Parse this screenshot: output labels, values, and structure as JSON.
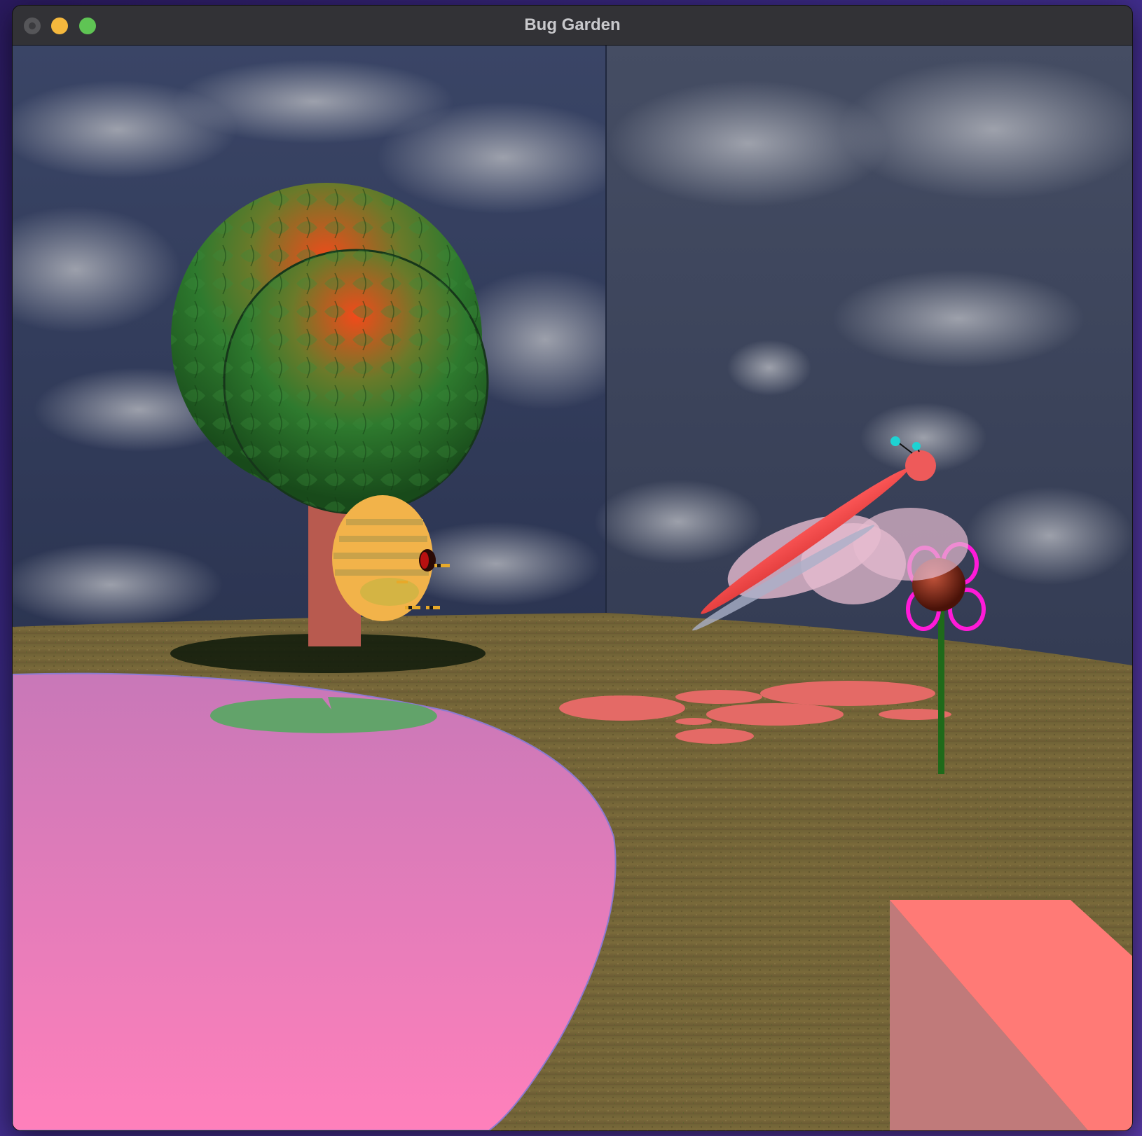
{
  "window": {
    "title": "Bug Garden",
    "controls": [
      "close",
      "minimize",
      "maximize"
    ]
  },
  "scene": {
    "objects": [
      "sky-wall-left",
      "sky-wall-right",
      "grass-ground",
      "tree",
      "beehive",
      "bees",
      "pond",
      "lily-pad",
      "dragonfly",
      "flower",
      "petal-patches",
      "pink-cube"
    ],
    "colors": {
      "pond": "#e47ab8",
      "lily_pad": "#62a36a",
      "tree_trunk": "#b85a4f",
      "beehive": "#f2b34a",
      "dragonfly": "#e84545",
      "flower_petals": "#ff1ad8",
      "flower_center": "#7a2418",
      "petal_patches": "#e46a66",
      "cube": "#f58a86",
      "grass": "#7a6a38"
    }
  }
}
